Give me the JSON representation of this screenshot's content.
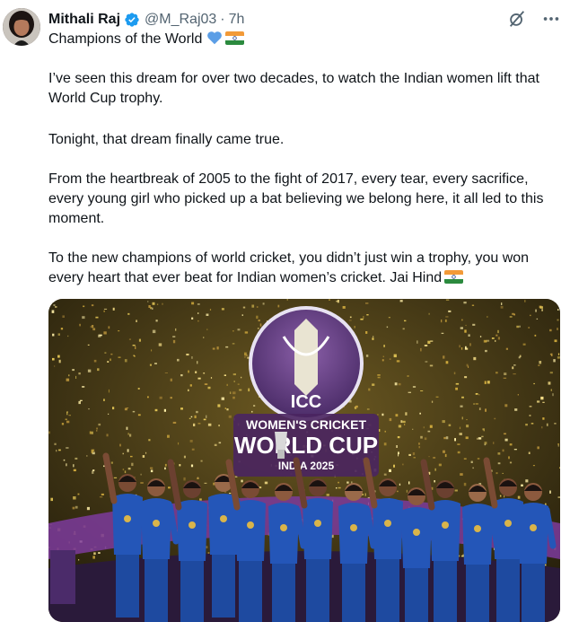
{
  "author": {
    "name": "Mithali Raj",
    "handle": "@M_Raj03",
    "separator": "·",
    "time": "7h"
  },
  "tweet": {
    "line1": "Champions of the World",
    "p1": "I’ve seen this dream for over two decades, to watch the Indian women lift that World Cup trophy.",
    "p2": "Tonight, that dream finally came true.",
    "p3": "From the heartbreak of 2005 to the fight of 2017, every tear, every sacrifice, every young girl who picked up a bat believing we belong here, it all led to this moment.",
    "p4": "To the new champions of world cricket, you didn’t just win a trophy, you won every heart that ever beat for Indian women’s cricket. Jai Hind"
  },
  "media": {
    "logo_icc": "ICC",
    "logo_line1": "WOMEN'S CRICKET",
    "logo_line2": "WORLD CUP",
    "logo_line3": "INDIA 2025"
  },
  "icons": {
    "avatar": "avatar",
    "verified": "verified-badge-icon",
    "grok": "grok-icon",
    "more": "more-options-icon",
    "heart": "blue-heart-emoji-icon",
    "flag": "india-flag-emoji-icon"
  },
  "colors": {
    "text": "#0f1419",
    "muted": "#536471",
    "verified": "#1d9bf0",
    "heart": "#5b9ee6",
    "jersey": "#2456b8",
    "confetti": "#d8b74a"
  }
}
